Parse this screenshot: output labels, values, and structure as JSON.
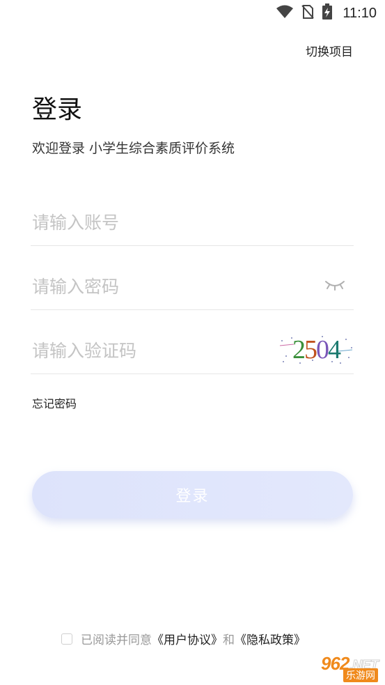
{
  "status_bar": {
    "time": "11:10",
    "icons": [
      "wifi-icon",
      "no-sim-icon",
      "battery-charging-icon"
    ]
  },
  "header": {
    "switch_project": "切换项目"
  },
  "title": "登录",
  "welcome": "欢迎登录 小学生综合素质评价系统",
  "form": {
    "account_placeholder": "请输入账号",
    "account_value": "",
    "password_placeholder": "请输入密码",
    "password_value": "",
    "captcha_placeholder": "请输入验证码",
    "captcha_value": "",
    "captcha_code": "2504",
    "captcha_colors": [
      "#3a8f3a",
      "#c0521e",
      "#7a56b8",
      "#1b7a6f"
    ]
  },
  "forgot_password": "忘记密码",
  "login_button": "登录",
  "agreement": {
    "prefix": "已阅读并同意",
    "user_agreement": "《用户协议》",
    "and": "和",
    "privacy_policy": "《隐私政策》",
    "checked": false
  },
  "watermark": {
    "top": "962",
    "net": ".NET",
    "bottom": "乐游网"
  },
  "colors": {
    "button_gradient_start": "#dde3fb",
    "button_gradient_end": "#e3e8fc",
    "placeholder": "#c4c4c4",
    "divider": "#e6e6e6"
  }
}
